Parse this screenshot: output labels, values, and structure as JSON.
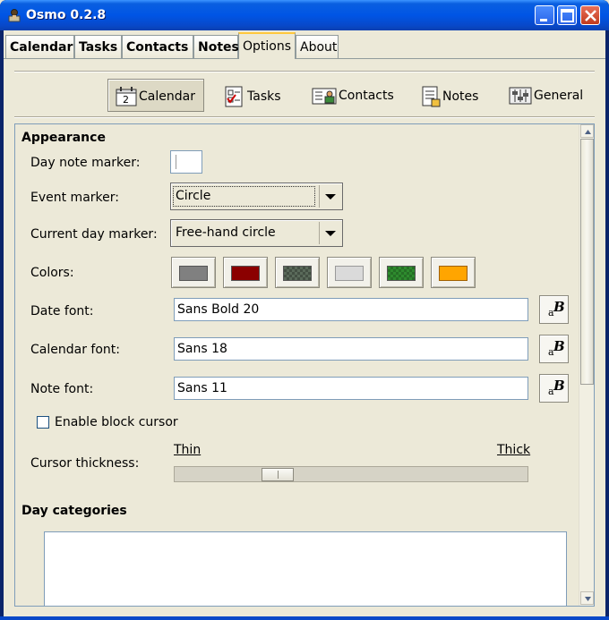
{
  "window": {
    "title": "Osmo 0.2.8"
  },
  "tabs": [
    {
      "label": "Calendar"
    },
    {
      "label": "Tasks"
    },
    {
      "label": "Contacts"
    },
    {
      "label": "Notes"
    },
    {
      "label": "Options"
    },
    {
      "label": "About"
    }
  ],
  "active_tab": "Options",
  "toolbar": {
    "items": [
      {
        "label": "Calendar",
        "icon": "calendar-icon"
      },
      {
        "label": "Tasks",
        "icon": "tasks-icon"
      },
      {
        "label": "Contacts",
        "icon": "contacts-icon"
      },
      {
        "label": "Notes",
        "icon": "notes-icon"
      },
      {
        "label": "General",
        "icon": "general-icon"
      }
    ],
    "active": "Calendar",
    "calendar_icon_text": "2"
  },
  "appearance": {
    "heading": "Appearance",
    "day_note_marker_label": "Day note marker:",
    "day_note_marker_value": "",
    "event_marker_label": "Event marker:",
    "event_marker_value": "Circle",
    "current_day_marker_label": "Current day marker:",
    "current_day_marker_value": "Free-hand circle",
    "colors_label": "Colors:",
    "colors": [
      "#808080",
      "#8b0000",
      "#5a6a5a",
      "#dadada",
      "#2e8b2e",
      "#ffa500"
    ],
    "date_font_label": "Date font:",
    "date_font_value": "Sans Bold 20",
    "calendar_font_label": "Calendar font:",
    "calendar_font_value": "Sans 18",
    "note_font_label": "Note font:",
    "note_font_value": "Sans 11",
    "font_button_a": "a",
    "font_button_b": "B",
    "block_cursor_label": "Enable block cursor",
    "block_cursor_checked": false,
    "cursor_thickness_label": "Cursor thickness:",
    "cursor_thin_label": "Thin",
    "cursor_thick_label": "Thick",
    "cursor_thickness_fraction": 0.27
  },
  "day_categories": {
    "heading": "Day categories"
  }
}
